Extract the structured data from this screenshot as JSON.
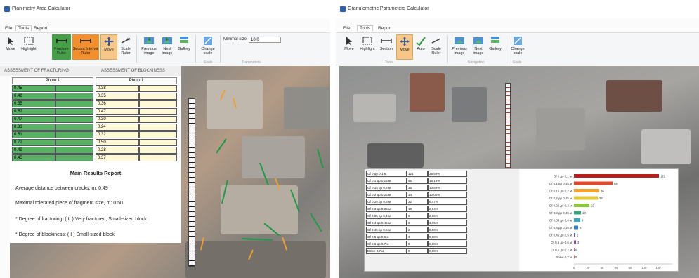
{
  "left_window": {
    "title": "Planimetry Area Calculator",
    "menu": [
      "File",
      "Tools",
      "Report"
    ],
    "toolbar": [
      {
        "label": "Move",
        "icon": "pointer-icon"
      },
      {
        "label": "Highlight",
        "icon": "marquee-icon"
      },
      {
        "label": "Fracture Ruler",
        "icon": "fracture-ruler-icon"
      },
      {
        "label": "Secant Interval Ruler",
        "icon": "secant-ruler-icon"
      },
      {
        "label": "Move",
        "icon": "pan-icon"
      },
      {
        "label": "Scale Ruler",
        "icon": "scale-ruler-icon"
      },
      {
        "label": "Previous image",
        "icon": "previous-image-icon"
      },
      {
        "label": "Next image",
        "icon": "next-image-icon"
      },
      {
        "label": "Gallery",
        "icon": "gallery-icon"
      },
      {
        "label": "Change scale",
        "icon": "change-scale-icon"
      }
    ],
    "groups": {
      "scale": "Scale",
      "parameters": "Parameters"
    },
    "minimal_size": {
      "label": "Minimal size",
      "value": "10.0"
    },
    "tabs": [
      "ASSESSMENT OF FRACTURING",
      "ASSESSMENT OF BLOCKINESS"
    ],
    "fracturing": {
      "header": "Photo 1",
      "values": [
        "0.45",
        "0.48",
        "0.55",
        "0.52",
        "0.47",
        "0.33",
        "0.51",
        "0.72",
        "0.49",
        "0.45"
      ]
    },
    "blockiness": {
      "header": "Photo 1",
      "values": [
        "0.38",
        "0.35",
        "0.36",
        "0.47",
        "0.30",
        "0.24",
        "0.32",
        "0.50",
        "0.28",
        "0.37"
      ]
    },
    "report": {
      "title": "Main Results Report",
      "line1": "Average distance between cracks, m: 0.49",
      "line2": "Maximal tolerated piece of fragment size, m: 0.50",
      "line3": "* Degree of fracturing: ( II )  Very fractured, Small-sized block",
      "line4": "* Degree of blockiness: ( I )  Small-sized block"
    }
  },
  "right_window": {
    "title": "Granulometric Parameters Calculator",
    "menu": [
      "File",
      "Tools",
      "Report"
    ],
    "toolbar": [
      {
        "label": "Move",
        "icon": "pointer-icon"
      },
      {
        "label": "Highlight",
        "icon": "marquee-icon"
      },
      {
        "label": "Section",
        "icon": "section-icon"
      },
      {
        "label": "Move",
        "icon": "pan-icon"
      },
      {
        "label": "Auto",
        "icon": "auto-icon"
      },
      {
        "label": "Scale Ruler",
        "icon": "scale-ruler-icon"
      },
      {
        "label": "Previous image",
        "icon": "previous-image-icon"
      },
      {
        "label": "Next image",
        "icon": "next-image-icon"
      },
      {
        "label": "Gallery",
        "icon": "gallery-icon"
      },
      {
        "label": "Change scale",
        "icon": "change-scale-icon"
      }
    ],
    "groups": {
      "tools": "Tools",
      "navigation": "Navigation",
      "scale": "Scale"
    },
    "table": [
      [
        "Of 0 до 0,1 м",
        "121",
        "35,59%"
      ],
      [
        "Of 0,1 до 0,15 м",
        "55",
        "16,18%"
      ],
      [
        "Of 0,15 до 0,2 м",
        "36",
        "10,59%"
      ],
      [
        "Of 0,2 до 0,25 м",
        "34",
        "10,00%"
      ],
      [
        "Of 0,25 до 0,3 м",
        "22",
        "6,47%"
      ],
      [
        "Of 0,3 до 0,35 м",
        "10",
        "2,94%"
      ],
      [
        "Of 0,35 до 0,4 м",
        "9",
        "2,65%"
      ],
      [
        "Of 0,4 до 0,45 м",
        "6",
        "1,76%"
      ],
      [
        "Of 0,45 до 0,5 м",
        "2",
        "0,59%"
      ],
      [
        "Of 0,5 до 0,6 м",
        "3",
        "0,88%"
      ],
      [
        "Of 0,6 до 0,7 м",
        "0",
        "0,00%"
      ],
      [
        "Bolee 0,7 м",
        "0",
        "0,00%"
      ]
    ]
  },
  "chart_data": {
    "type": "bar",
    "orientation": "horizontal",
    "categories": [
      "Of 0 до 0,1 м",
      "Of 0,1 до 0,15 м",
      "Of 0,15 до 0,2 м",
      "Of 0,2 до 0,25 м",
      "Of 0,25 до 0,3 м",
      "Of 0,3 до 0,35 м",
      "Of 0,35 до 0,4 м",
      "Of 0,4 до 0,45 м",
      "Of 0,45 до 0,5 м",
      "Of 0,5 до 0,6 м",
      "Of 0,6 до 0,7 м",
      "Bolee 0,7 м"
    ],
    "values": [
      121,
      55,
      36,
      34,
      22,
      10,
      9,
      6,
      2,
      3,
      0,
      0
    ],
    "colors": [
      "#b8201d",
      "#e4492c",
      "#f2a533",
      "#e0c93a",
      "#8ec640",
      "#33a37a",
      "#36a7c2",
      "#2f7fcf",
      "#5b59c2",
      "#8e44ad",
      "#c23a6b",
      "#d23c3c"
    ],
    "xlim": [
      0,
      140
    ],
    "xticks": [
      "0",
      "20",
      "40",
      "60",
      "80",
      "100",
      "120"
    ],
    "grid": false
  }
}
